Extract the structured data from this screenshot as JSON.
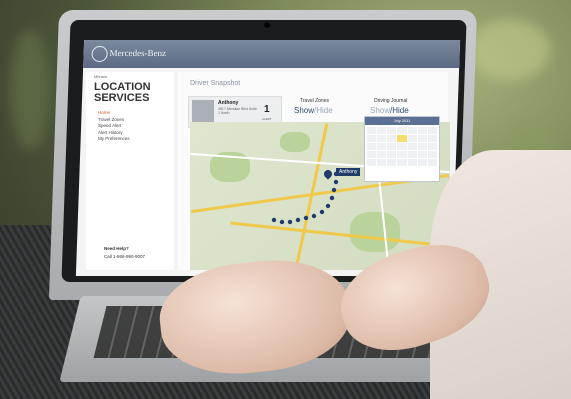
{
  "screen": {
    "brand": "Mercedes-Benz",
    "breadcrumb": "Mbrace",
    "sidebar": {
      "title": "LOCATION SERVICES",
      "items": [
        "Home",
        "Travel Zones",
        "Speed Alert",
        "Alert History",
        "My Preferences"
      ],
      "help_heading": "Need Help?",
      "help_phone": "Call 1-866-990-9007"
    },
    "main": {
      "title": "Driver Snapshot",
      "driver": {
        "name": "Anthony",
        "address": "4517 Meridian Blvd Suite 1 North",
        "alert_count": "1",
        "alert_label": "ALERT"
      },
      "travel_zones": {
        "label": "Travel Zones",
        "show": "Show",
        "separator": "/",
        "hide": "Hide"
      },
      "driving_journal": {
        "label": "Driving Journal",
        "show": "Show",
        "separator": "/",
        "hide": "Hide"
      },
      "map_pin_label": "Anthony",
      "calendar_header": "July 2011"
    }
  },
  "colors": {
    "topbar": "#5b6a82",
    "accent": "#d9541e",
    "link": "#2b4a7a",
    "route": "#1f3a6b"
  }
}
